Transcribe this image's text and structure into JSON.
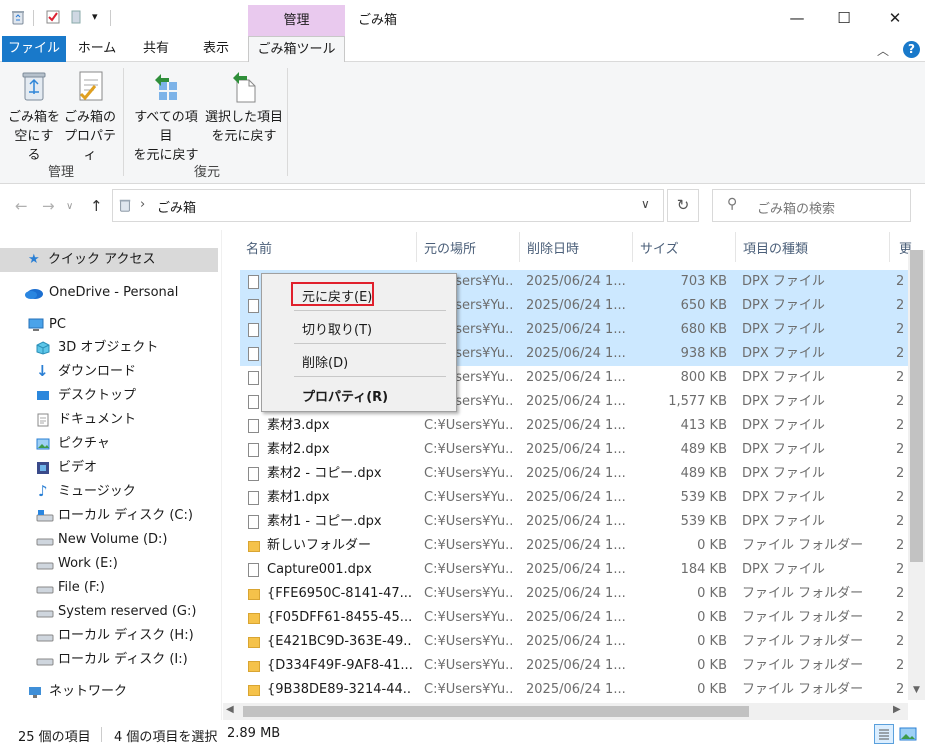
{
  "window": {
    "title": "ごみ箱",
    "context_tab_header": "管理",
    "minimize": "—",
    "maximize": "☐",
    "close": "✕"
  },
  "ribbon_tabs": [
    "ファイル",
    "ホーム",
    "共有",
    "表示",
    "ごみ箱ツール"
  ],
  "ribbon": {
    "buttons": [
      {
        "line1": "ごみ箱を",
        "line2": "空にする"
      },
      {
        "line1": "ごみ箱の",
        "line2": "プロパティ"
      },
      {
        "line1": "すべての項目",
        "line2": "を元に戻す"
      },
      {
        "line1": "選択した項目",
        "line2": "を元に戻す"
      }
    ],
    "groups": [
      "管理",
      "復元"
    ]
  },
  "address": {
    "path": "ごみ箱",
    "search_placeholder": "ごみ箱の検索"
  },
  "nav": {
    "items": [
      "クイック アクセス",
      "OneDrive - Personal",
      "PC",
      "3D オブジェクト",
      "ダウンロード",
      "デスクトップ",
      "ドキュメント",
      "ピクチャ",
      "ビデオ",
      "ミュージック",
      "ローカル ディスク (C:)",
      "New Volume (D:)",
      "Work (E:)",
      "File (F:)",
      "System reserved (G:)",
      "ローカル ディスク (H:)",
      "ローカル ディスク (I:)",
      "ネットワーク"
    ]
  },
  "columns": [
    "名前",
    "元の場所",
    "削除日時",
    "サイズ",
    "項目の種類",
    "更"
  ],
  "rows": [
    {
      "name": "",
      "loc": "C:¥Users¥Yu...",
      "date": "2025/06/24 1...",
      "size": "703 KB",
      "type": "DPX ファイル",
      "extra": "2"
    },
    {
      "name": "",
      "loc": "C:¥Users¥Yu...",
      "date": "2025/06/24 1...",
      "size": "650 KB",
      "type": "DPX ファイル",
      "extra": "2"
    },
    {
      "name": "",
      "loc": "C:¥Users¥Yu...",
      "date": "2025/06/24 1...",
      "size": "680 KB",
      "type": "DPX ファイル",
      "extra": "2"
    },
    {
      "name": "",
      "loc": "C:¥Users¥Yu...",
      "date": "2025/06/24 1...",
      "size": "938 KB",
      "type": "DPX ファイル",
      "extra": "2"
    },
    {
      "name": "",
      "loc": "C:¥Users¥Yu...",
      "date": "2025/06/24 1...",
      "size": "800 KB",
      "type": "DPX ファイル",
      "extra": "2"
    },
    {
      "name": "",
      "loc": "C:¥Users¥Yu...",
      "date": "2025/06/24 1...",
      "size": "1,577 KB",
      "type": "DPX ファイル",
      "extra": "2"
    },
    {
      "name": "素材3.dpx",
      "loc": "C:¥Users¥Yu...",
      "date": "2025/06/24 1...",
      "size": "413 KB",
      "type": "DPX ファイル",
      "extra": "2"
    },
    {
      "name": "素材2.dpx",
      "loc": "C:¥Users¥Yu...",
      "date": "2025/06/24 1...",
      "size": "489 KB",
      "type": "DPX ファイル",
      "extra": "2"
    },
    {
      "name": "素材2 - コピー.dpx",
      "loc": "C:¥Users¥Yu...",
      "date": "2025/06/24 1...",
      "size": "489 KB",
      "type": "DPX ファイル",
      "extra": "2"
    },
    {
      "name": "素材1.dpx",
      "loc": "C:¥Users¥Yu...",
      "date": "2025/06/24 1...",
      "size": "539 KB",
      "type": "DPX ファイル",
      "extra": "2"
    },
    {
      "name": "素材1 - コピー.dpx",
      "loc": "C:¥Users¥Yu...",
      "date": "2025/06/24 1...",
      "size": "539 KB",
      "type": "DPX ファイル",
      "extra": "2"
    },
    {
      "name": "新しいフォルダー",
      "loc": "C:¥Users¥Yu...",
      "date": "2025/06/24 1...",
      "size": "0 KB",
      "type": "ファイル フォルダー",
      "extra": "2"
    },
    {
      "name": "Capture001.dpx",
      "loc": "C:¥Users¥Yu...",
      "date": "2025/06/24 1...",
      "size": "184 KB",
      "type": "DPX ファイル",
      "extra": "2"
    },
    {
      "name": "{FFE6950C-8141-47...",
      "loc": "C:¥Users¥Yu...",
      "date": "2025/06/24 1...",
      "size": "0 KB",
      "type": "ファイル フォルダー",
      "extra": "2"
    },
    {
      "name": "{F05DFF61-8455-45...",
      "loc": "C:¥Users¥Yu...",
      "date": "2025/06/24 1...",
      "size": "0 KB",
      "type": "ファイル フォルダー",
      "extra": "2"
    },
    {
      "name": "{E421BC9D-363E-49...",
      "loc": "C:¥Users¥Yu...",
      "date": "2025/06/24 1...",
      "size": "0 KB",
      "type": "ファイル フォルダー",
      "extra": "2"
    },
    {
      "name": "{D334F49F-9AF8-41...",
      "loc": "C:¥Users¥Yu...",
      "date": "2025/06/24 1...",
      "size": "0 KB",
      "type": "ファイル フォルダー",
      "extra": "2"
    },
    {
      "name": "{9B38DE89-3214-44...",
      "loc": "C:¥Users¥Yu...",
      "date": "2025/06/24 1...",
      "size": "0 KB",
      "type": "ファイル フォルダー",
      "extra": "2"
    }
  ],
  "selected_rows": [
    0,
    1,
    2,
    3
  ],
  "folder_rows": [
    11,
    13,
    14,
    15,
    16,
    17
  ],
  "context_menu": {
    "restore": "元に戻す(E)",
    "cut": "切り取り(T)",
    "delete": "削除(D)",
    "properties": "プロパティ(R)"
  },
  "status": {
    "count": "25 個の項目",
    "selected": "4 個の項目を選択",
    "size": "2.89 MB"
  },
  "colors": {
    "accent": "#1979ca",
    "selection": "#cce8ff",
    "context_tab": "#e9c9ee",
    "highlight_box": "#e0202c"
  }
}
